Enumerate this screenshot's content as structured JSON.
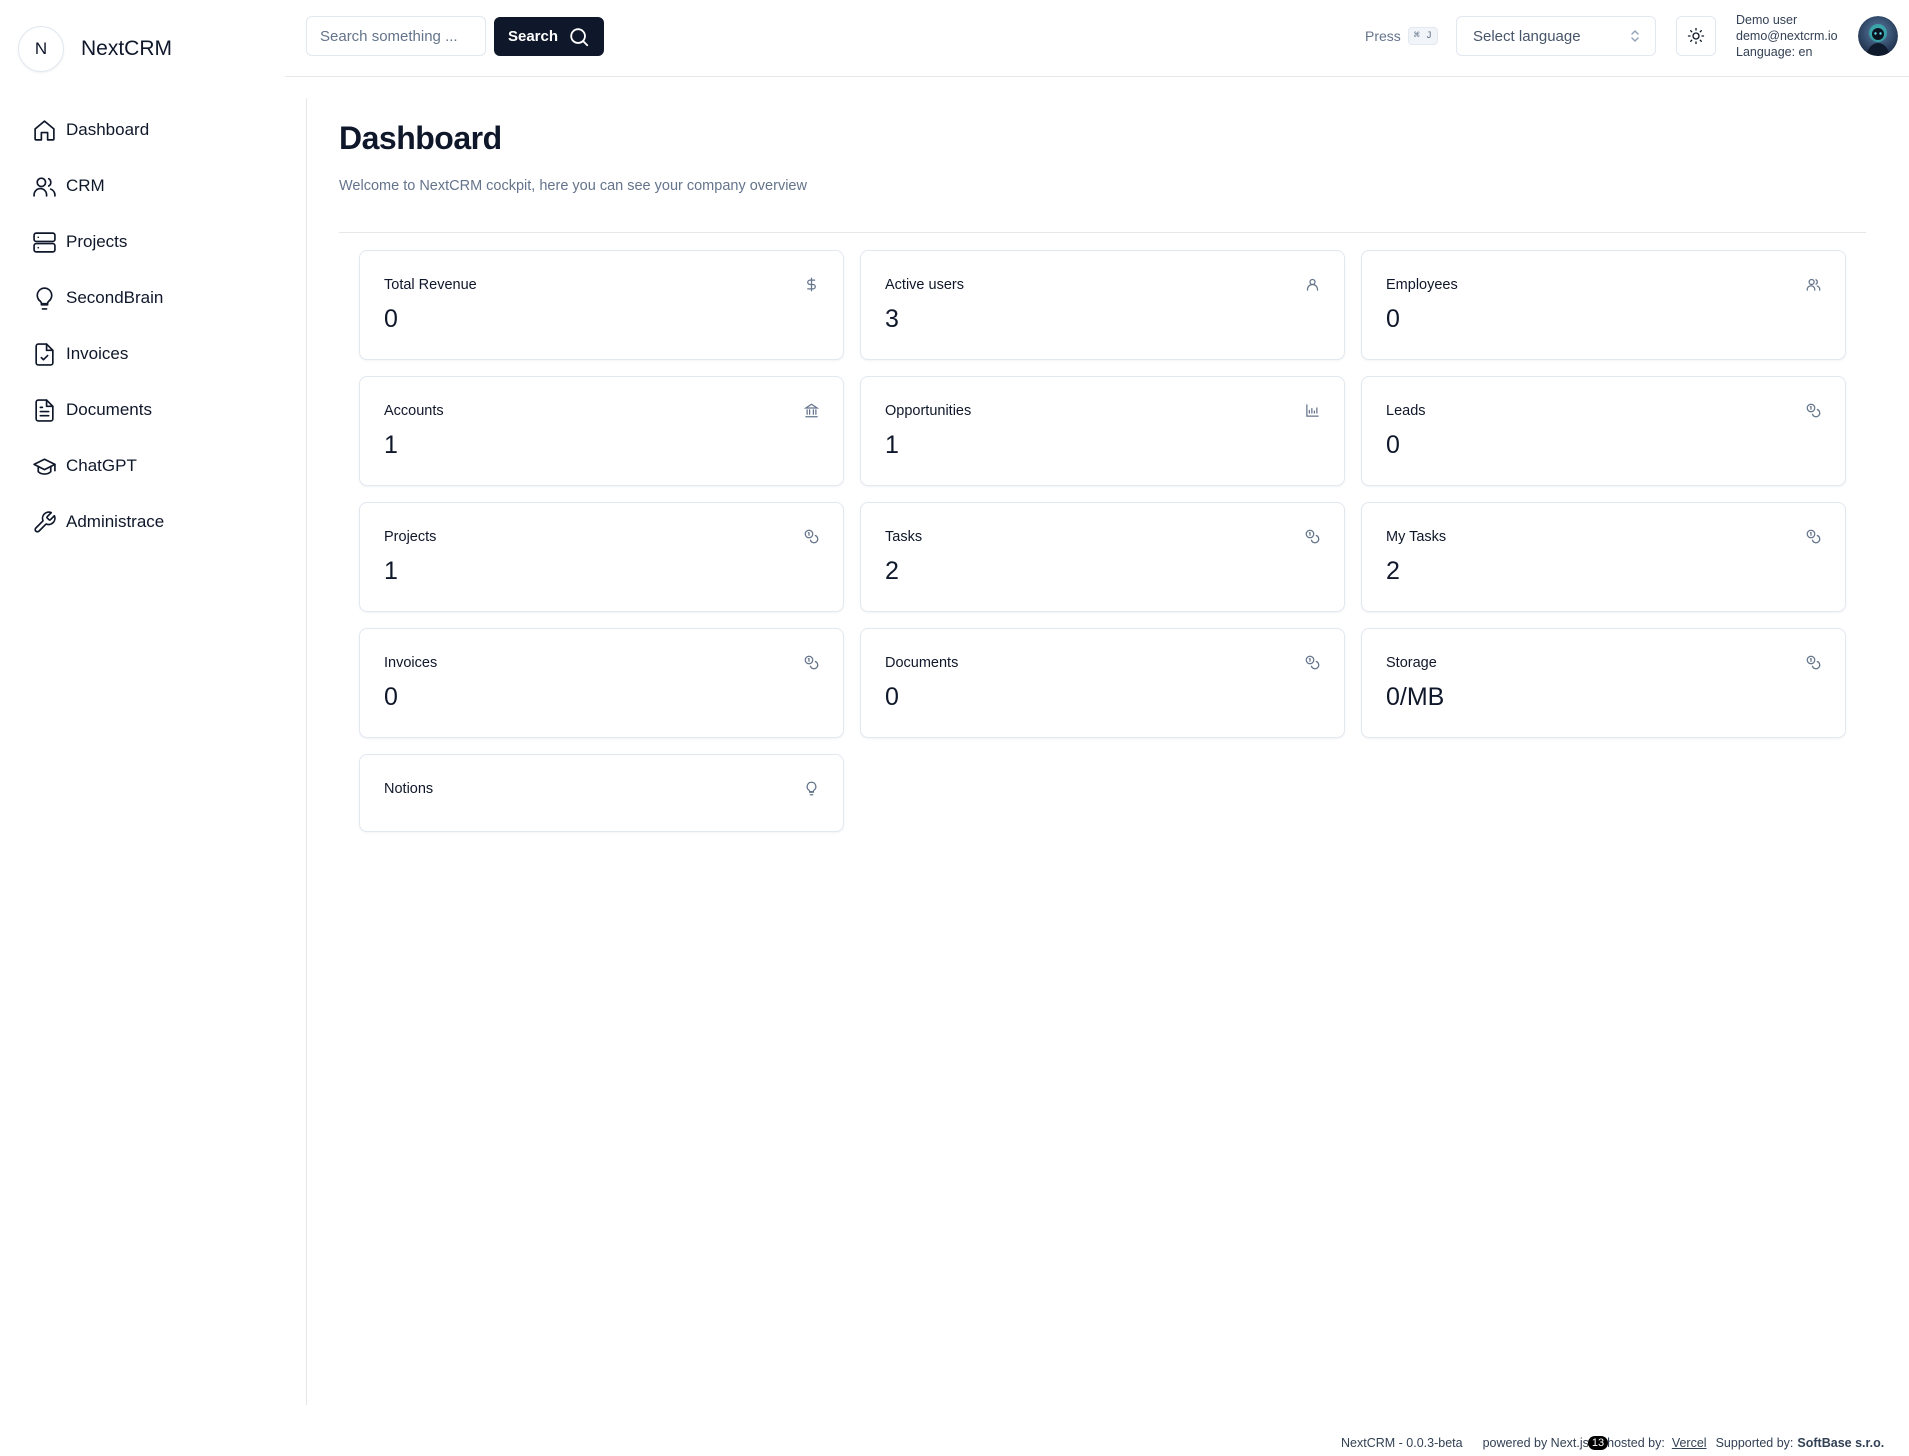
{
  "brand": {
    "logo_letter": "N",
    "name": "NextCRM"
  },
  "sidebar": {
    "items": [
      {
        "label": "Dashboard",
        "icon": "home-icon"
      },
      {
        "label": "CRM",
        "icon": "users-icon"
      },
      {
        "label": "Projects",
        "icon": "server-icon"
      },
      {
        "label": "SecondBrain",
        "icon": "lightbulb-icon"
      },
      {
        "label": "Invoices",
        "icon": "file-check-icon"
      },
      {
        "label": "Documents",
        "icon": "file-text-icon"
      },
      {
        "label": "ChatGPT",
        "icon": "graduation-cap-icon"
      },
      {
        "label": "Administrace",
        "icon": "wrench-icon"
      }
    ]
  },
  "topbar": {
    "search_placeholder": "Search something ...",
    "search_button": "Search",
    "press_label": "Press",
    "shortcut": "⌘ J",
    "language_placeholder": "Select language",
    "user": {
      "name": "Demo user",
      "email": "demo@nextcrm.io",
      "language": "Language: en"
    }
  },
  "main": {
    "title": "Dashboard",
    "description": "Welcome to NextCRM cockpit, here you can see your company overview",
    "cards": [
      {
        "title": "Total Revenue",
        "value": "0",
        "icon": "dollar-sign-icon"
      },
      {
        "title": "Active users",
        "value": "3",
        "icon": "user-icon"
      },
      {
        "title": "Employees",
        "value": "0",
        "icon": "users-icon"
      },
      {
        "title": "Accounts",
        "value": "1",
        "icon": "landmark-icon"
      },
      {
        "title": "Opportunities",
        "value": "1",
        "icon": "chart-icon"
      },
      {
        "title": "Leads",
        "value": "0",
        "icon": "coins-icon"
      },
      {
        "title": "Projects",
        "value": "1",
        "icon": "coins-icon"
      },
      {
        "title": "Tasks",
        "value": "2",
        "icon": "coins-icon"
      },
      {
        "title": "My Tasks",
        "value": "2",
        "icon": "coins-icon"
      },
      {
        "title": "Invoices",
        "value": "0",
        "icon": "coins-icon"
      },
      {
        "title": "Documents",
        "value": "0",
        "icon": "coins-icon"
      },
      {
        "title": "Storage",
        "value": "0/MB",
        "icon": "coins-icon"
      },
      {
        "title": "Notions",
        "value": "",
        "icon": "lightbulb-icon"
      }
    ]
  },
  "footer": {
    "version": "NextCRM - 0.0.3-beta",
    "powered_by": "powered by Next.js",
    "next_version": "13",
    "hosted_by": "hosted by:",
    "host_link": "Vercel",
    "supported_by": "Supported by:",
    "supporter": "SoftBase s.r.o."
  }
}
